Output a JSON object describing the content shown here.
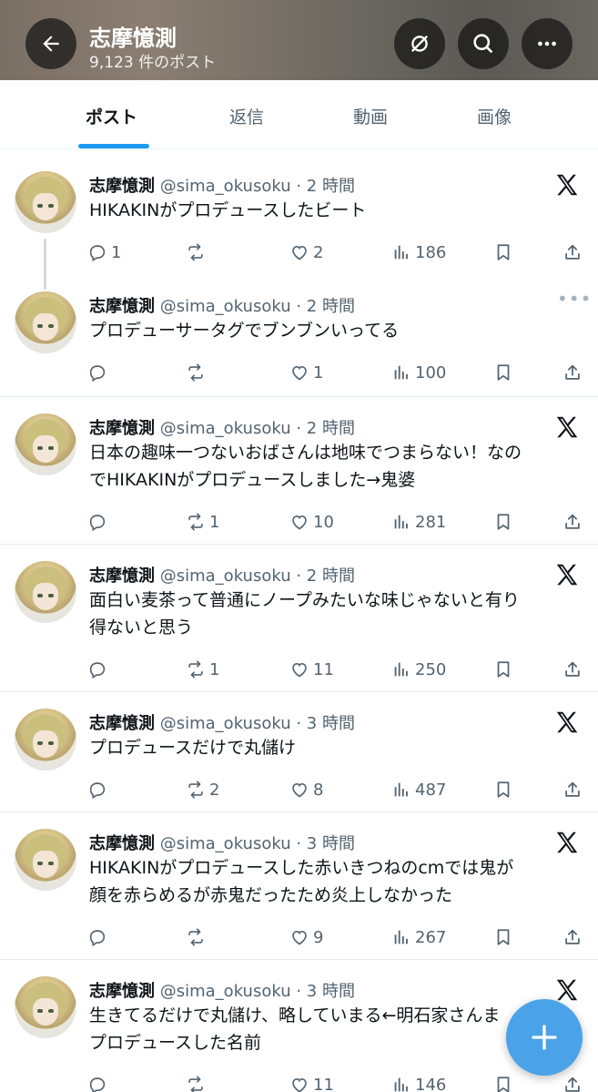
{
  "header": {
    "title": "志摩憶測",
    "subtitle": "9,123 件のポスト",
    "back_icon": "arrow-left-icon",
    "icons": [
      "no-notify-icon",
      "search-icon",
      "more-icon"
    ]
  },
  "tabs": [
    {
      "label": "ポスト",
      "active": true
    },
    {
      "label": "返信",
      "active": false
    },
    {
      "label": "動画",
      "active": false
    },
    {
      "label": "画像",
      "active": false
    }
  ],
  "posts": [
    {
      "name": "志摩憶測",
      "meta": "@sima_okusoku · 2 時間",
      "lines": [
        "HIKAKINがプロデュースしたビート"
      ],
      "reply": "1",
      "retweet": "",
      "like": "2",
      "views": "186",
      "corner": "x"
    },
    {
      "name": "志摩憶測",
      "meta": "@sima_okusoku · 2 時間",
      "lines": [
        "プロデューサータグでブンブンいってる"
      ],
      "reply": "",
      "retweet": "",
      "like": "1",
      "views": "100",
      "corner": "more"
    },
    {
      "name": "志摩憶測",
      "meta": "@sima_okusoku · 2 時間",
      "lines": [
        "日本の趣味一つないおばさんは地味でつまらない！なの",
        "でHIKAKINがプロデュースしました→鬼婆"
      ],
      "reply": "",
      "retweet": "1",
      "like": "10",
      "views": "281",
      "corner": "x"
    },
    {
      "name": "志摩憶測",
      "meta": "@sima_okusoku · 2 時間",
      "lines": [
        "面白い麦茶って普通にノープみたいな味じゃないと有り",
        "得ないと思う"
      ],
      "reply": "",
      "retweet": "1",
      "like": "11",
      "views": "250",
      "corner": "x"
    },
    {
      "name": "志摩憶測",
      "meta": "@sima_okusoku · 3 時間",
      "lines": [
        "プロデュースだけで丸儲け"
      ],
      "reply": "",
      "retweet": "2",
      "like": "8",
      "views": "487",
      "corner": "x"
    },
    {
      "name": "志摩憶測",
      "meta": "@sima_okusoku · 3 時間",
      "lines": [
        "HIKAKINがプロデュースした赤いきつねのcmでは鬼が",
        "顔を赤らめるが赤鬼だったため炎上しなかった"
      ],
      "reply": "",
      "retweet": "",
      "like": "9",
      "views": "267",
      "corner": "x"
    },
    {
      "name": "志摩憶測",
      "meta": "@sima_okusoku · 3 時間",
      "lines": [
        "生きてるだけで丸儲け、略していまる←明石家さんま",
        "プロデュースした名前"
      ],
      "reply": "",
      "retweet": "",
      "like": "11",
      "views": "146",
      "corner": "x"
    }
  ],
  "fab": {
    "icon": "plus-icon"
  },
  "colors": {
    "accent": "#1d9bf0",
    "fab": "#4aa3e8",
    "muted": "#536471"
  }
}
